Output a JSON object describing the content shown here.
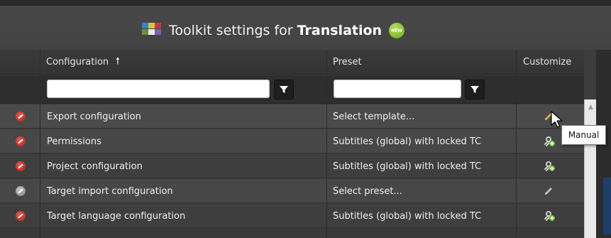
{
  "header": {
    "title_prefix": "Toolkit settings for",
    "title_bold": "Translation",
    "new_badge": "NEW",
    "app_icon": "toolkit-icon"
  },
  "grid": {
    "columns": {
      "configuration": "Configuration",
      "configuration_sort_icon": "arrow-up-icon",
      "preset": "Preset",
      "customize": "Customize"
    },
    "filters": {
      "configuration_value": "",
      "configuration_placeholder": "",
      "preset_value": "",
      "preset_placeholder": "",
      "filter_icon": "funnel-icon"
    },
    "rows": [
      {
        "status": "not-allowed-red",
        "configuration": "Export configuration",
        "preset": "Select template...",
        "customize_icon": "pencil-icon"
      },
      {
        "status": "not-allowed-red",
        "configuration": "Permissions",
        "preset": "Subtitles (global) with locked TC",
        "customize_icon": "link-add-icon"
      },
      {
        "status": "not-allowed-red",
        "configuration": "Project configuration",
        "preset": "Subtitles (global) with locked TC",
        "customize_icon": "link-add-icon"
      },
      {
        "status": "not-allowed-grey",
        "configuration": "Target import configuration",
        "preset": "Select preset...",
        "customize_icon": "pencil-icon"
      },
      {
        "status": "not-allowed-red",
        "configuration": "Target language configuration",
        "preset": "Subtitles (global) with locked TC",
        "customize_icon": "link-add-icon"
      }
    ]
  },
  "tooltip": {
    "text": "Manual"
  },
  "colors": {
    "background": "#3d3d3d",
    "row_odd": "#3e3e3e",
    "row_even": "#474747",
    "status_red": "#c0392b",
    "badge_green": "#8cc63f"
  }
}
